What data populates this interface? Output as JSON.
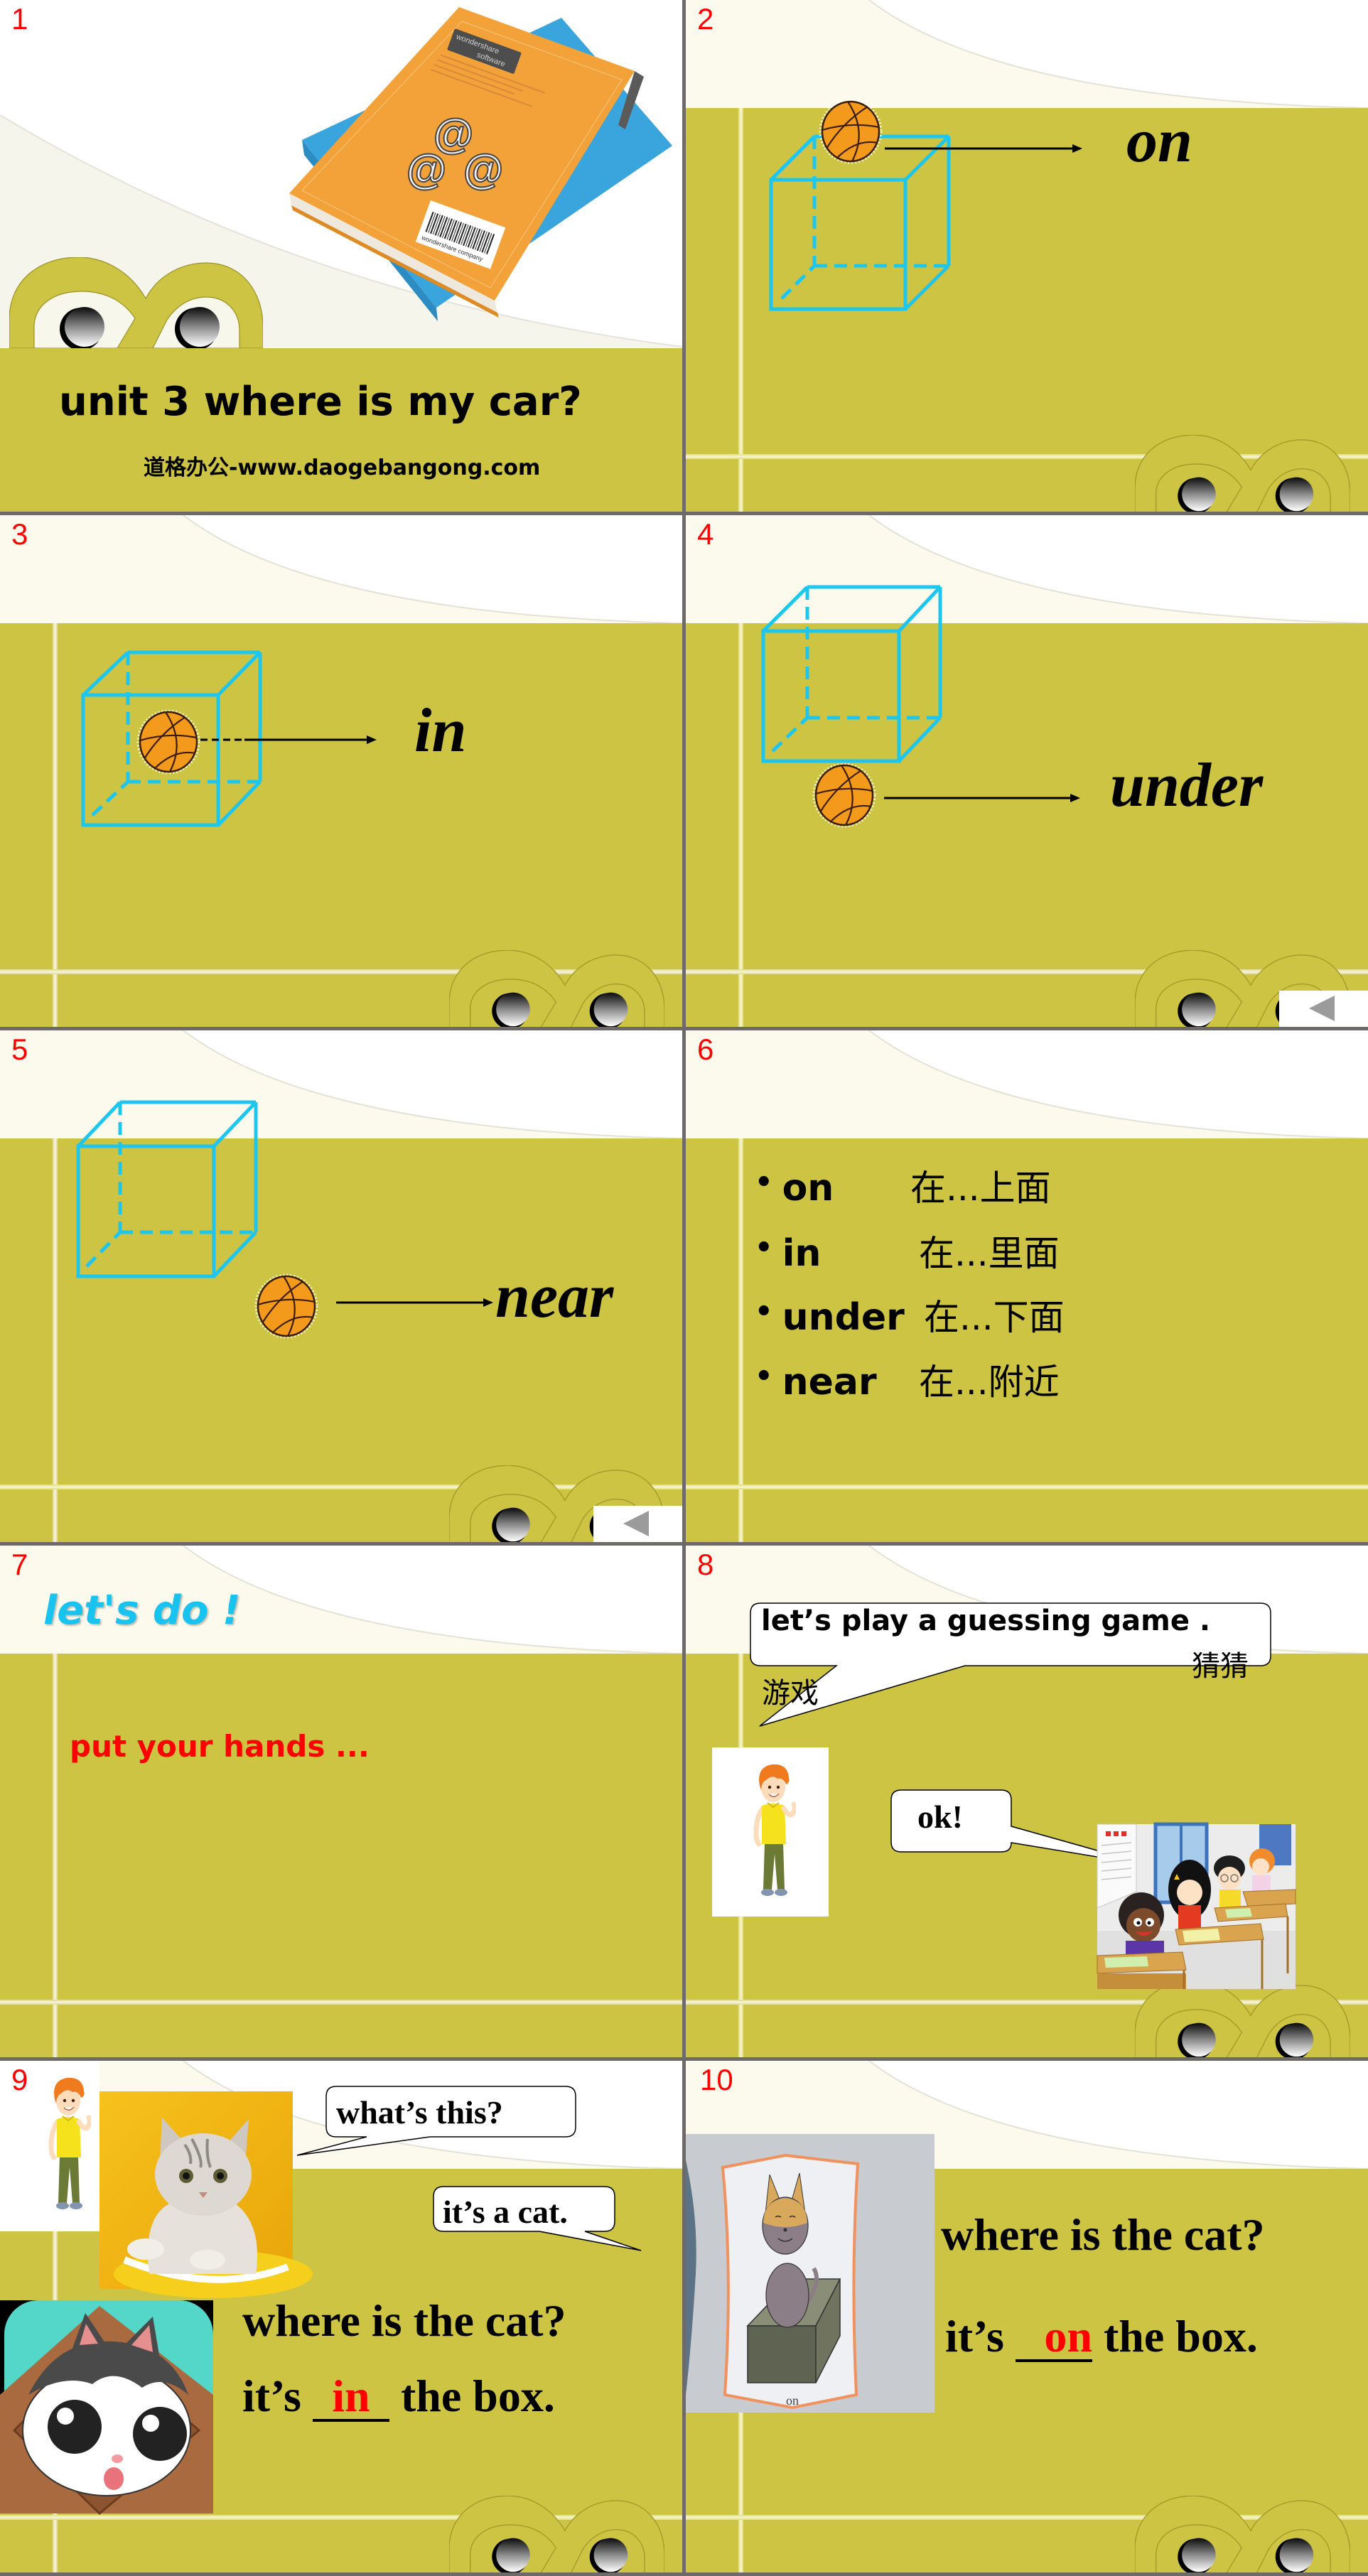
{
  "slides": [
    {
      "number": "1",
      "title": "unit 3 where is my car?",
      "subtitle": "道格办公-www.daogebangong.com",
      "photo": {
        "cover_label_line1": "wondershare",
        "cover_label_line2": "software",
        "emblem": "@",
        "barcode_caption": "wondershare company"
      }
    },
    {
      "number": "2",
      "word": "on"
    },
    {
      "number": "3",
      "word": "in"
    },
    {
      "number": "4",
      "word": "under"
    },
    {
      "number": "5",
      "word": "near"
    },
    {
      "number": "6",
      "vocab": [
        {
          "bullet": "•",
          "en": "on",
          "zh": "在...上面"
        },
        {
          "bullet": "•",
          "en": "in",
          "zh": "在...里面"
        },
        {
          "bullet": "•",
          "en": "under",
          "zh": "在...下面"
        },
        {
          "bullet": "•",
          "en": "near",
          "zh": "在...附近"
        }
      ]
    },
    {
      "number": "7",
      "heading": "let's do !",
      "instruction": "put your hands ..."
    },
    {
      "number": "8",
      "prompt": "let’s play a guessing game .",
      "gloss_game": "游戏",
      "gloss_guess": "猜猜",
      "reply": "ok!"
    },
    {
      "number": "9",
      "question_bubble": "what’s this?",
      "answer_bubble": "it’s a cat.",
      "question": "where is the cat?",
      "answer_prefix": "it’s",
      "answer_blank": "in",
      "answer_suffix": "the box."
    },
    {
      "number": "10",
      "picture_caption": "on",
      "question": "where is the cat?",
      "answer_prefix": "it’s",
      "answer_blank": "on",
      "answer_suffix": "the box."
    }
  ],
  "icons": {
    "back_button": "triangle-left-icon",
    "position_arrow": "arrow-right-icon",
    "ball": "basketball-icon",
    "box": "cube-outline-icon",
    "decoration": "peeking-eyes-icon"
  },
  "colors": {
    "olive_band": "#CCC442",
    "cube_outline": "#1DC6EE",
    "slide_number": "#FF0000",
    "heading_cyan": "#19C3F0",
    "instruction_red": "#FF0000",
    "answer_red": "#FF0000",
    "basketball": "#F39A1D"
  }
}
